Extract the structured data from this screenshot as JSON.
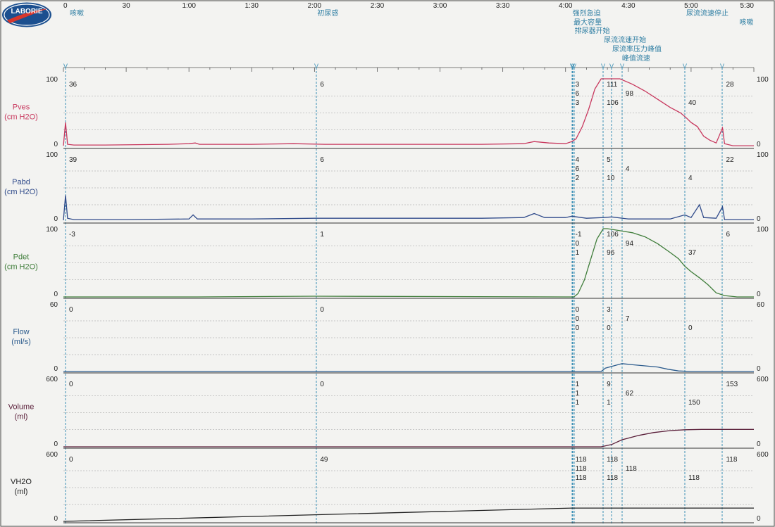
{
  "logo": {
    "text": "LABORIE",
    "colors": {
      "outer": "#1b4f8f",
      "inner": "#ffffff",
      "swoosh": "#d8362c"
    }
  },
  "chart_data": {
    "type": "line",
    "title": "",
    "time_axis": {
      "unit": "seconds",
      "range": [
        0,
        330
      ],
      "ticks": [
        {
          "t": 0,
          "label": "0"
        },
        {
          "t": 30,
          "label": "30"
        },
        {
          "t": 60,
          "label": "1:00"
        },
        {
          "t": 90,
          "label": "1:30"
        },
        {
          "t": 120,
          "label": "2:00"
        },
        {
          "t": 150,
          "label": "2:30"
        },
        {
          "t": 180,
          "label": "3:00"
        },
        {
          "t": 210,
          "label": "3:30"
        },
        {
          "t": 240,
          "label": "4:00"
        },
        {
          "t": 270,
          "label": "4:30"
        },
        {
          "t": 300,
          "label": "5:00"
        },
        {
          "t": 330,
          "label": "5:30"
        }
      ]
    },
    "events": [
      {
        "t": 1,
        "label": "咳嗽"
      },
      {
        "t": 121,
        "label": "初尿感"
      },
      {
        "t": 243,
        "label": "强烈急迫"
      },
      {
        "t": 243.5,
        "label": "最大容量"
      },
      {
        "t": 244,
        "label": "排尿器开始"
      },
      {
        "t": 258,
        "label": "尿流流速开始"
      },
      {
        "t": 262,
        "label": "尿流率压力峰值"
      },
      {
        "t": 267,
        "label": "峰值流速"
      },
      {
        "t": 297,
        "label": "尿流流速停止"
      },
      {
        "t": 315,
        "label": "咳嗽"
      }
    ],
    "channels": [
      {
        "name": "Pves",
        "unit": "(cm H2O)",
        "color": "#c8385e",
        "ymin": 0,
        "ymax": 100,
        "ymin_label": "0",
        "ymax_label": "100",
        "readouts": [
          {
            "t": 1,
            "values": [
              "36"
            ]
          },
          {
            "t": 121,
            "values": [
              "6"
            ]
          },
          {
            "t": 243,
            "values": [
              "3",
              "6",
              "3"
            ]
          },
          {
            "t": 258,
            "values": [
              "111",
              "106"
            ]
          },
          {
            "t": 267,
            "values": [
              "98"
            ]
          },
          {
            "t": 297,
            "values": [
              "40"
            ]
          },
          {
            "t": 315,
            "values": [
              "28"
            ]
          }
        ],
        "points": [
          [
            0,
            2
          ],
          [
            1,
            36
          ],
          [
            2,
            4
          ],
          [
            5,
            3
          ],
          [
            20,
            3
          ],
          [
            50,
            4
          ],
          [
            60,
            5
          ],
          [
            63,
            6
          ],
          [
            65,
            4
          ],
          [
            90,
            4
          ],
          [
            110,
            5
          ],
          [
            125,
            4
          ],
          [
            140,
            4
          ],
          [
            200,
            4
          ],
          [
            220,
            5
          ],
          [
            225,
            8
          ],
          [
            232,
            6
          ],
          [
            240,
            5
          ],
          [
            243,
            8
          ],
          [
            245,
            12
          ],
          [
            248,
            30
          ],
          [
            251,
            55
          ],
          [
            254,
            85
          ],
          [
            257,
            105
          ],
          [
            259,
            111
          ],
          [
            262,
            108
          ],
          [
            266,
            100
          ],
          [
            272,
            92
          ],
          [
            278,
            82
          ],
          [
            284,
            70
          ],
          [
            290,
            58
          ],
          [
            295,
            50
          ],
          [
            298,
            42
          ],
          [
            300,
            36
          ],
          [
            303,
            30
          ],
          [
            306,
            16
          ],
          [
            309,
            10
          ],
          [
            312,
            6
          ],
          [
            315,
            28
          ],
          [
            316,
            5
          ],
          [
            320,
            2
          ],
          [
            330,
            2
          ]
        ]
      },
      {
        "name": "Pabd",
        "unit": "(cm H2O)",
        "color": "#2f4a8a",
        "ymin": 0,
        "ymax": 100,
        "ymin_label": "0",
        "ymax_label": "100",
        "readouts": [
          {
            "t": 1,
            "values": [
              "39"
            ]
          },
          {
            "t": 121,
            "values": [
              "6"
            ]
          },
          {
            "t": 243,
            "values": [
              "4",
              "6",
              "2"
            ]
          },
          {
            "t": 258,
            "values": [
              "5",
              "10"
            ]
          },
          {
            "t": 267,
            "values": [
              "4"
            ]
          },
          {
            "t": 297,
            "values": [
              "4"
            ]
          },
          {
            "t": 315,
            "values": [
              "22"
            ]
          }
        ],
        "points": [
          [
            0,
            2
          ],
          [
            1,
            39
          ],
          [
            2,
            5
          ],
          [
            5,
            3
          ],
          [
            30,
            3
          ],
          [
            60,
            4
          ],
          [
            62,
            10
          ],
          [
            64,
            4
          ],
          [
            90,
            4
          ],
          [
            120,
            5
          ],
          [
            200,
            5
          ],
          [
            220,
            6
          ],
          [
            225,
            12
          ],
          [
            230,
            6
          ],
          [
            240,
            6
          ],
          [
            243,
            8
          ],
          [
            250,
            5
          ],
          [
            258,
            6
          ],
          [
            262,
            7
          ],
          [
            270,
            4
          ],
          [
            290,
            4
          ],
          [
            297,
            10
          ],
          [
            300,
            6
          ],
          [
            304,
            25
          ],
          [
            306,
            6
          ],
          [
            312,
            5
          ],
          [
            315,
            22
          ],
          [
            316,
            3
          ],
          [
            330,
            3
          ]
        ]
      },
      {
        "name": "Pdet",
        "unit": "(cm H2O)",
        "color": "#3f7d3a",
        "ymin": 0,
        "ymax": 100,
        "ymin_label": "0",
        "ymax_label": "100",
        "readouts": [
          {
            "t": 1,
            "values": [
              "-3"
            ]
          },
          {
            "t": 121,
            "values": [
              "1"
            ]
          },
          {
            "t": 243,
            "values": [
              "-1",
              "0",
              "1"
            ]
          },
          {
            "t": 258,
            "values": [
              "106",
              "96"
            ]
          },
          {
            "t": 267,
            "values": [
              "94"
            ]
          },
          {
            "t": 297,
            "values": [
              "37"
            ]
          },
          {
            "t": 315,
            "values": [
              "6"
            ]
          }
        ],
        "points": [
          [
            0,
            0
          ],
          [
            1,
            -3
          ],
          [
            3,
            0
          ],
          [
            60,
            0
          ],
          [
            62,
            -3
          ],
          [
            64,
            0
          ],
          [
            120,
            1
          ],
          [
            240,
            0
          ],
          [
            244,
            -1
          ],
          [
            246,
            5
          ],
          [
            249,
            25
          ],
          [
            252,
            55
          ],
          [
            255,
            85
          ],
          [
            258,
            100
          ],
          [
            260,
            106
          ],
          [
            264,
            98
          ],
          [
            268,
            96
          ],
          [
            272,
            94
          ],
          [
            278,
            88
          ],
          [
            284,
            78
          ],
          [
            290,
            65
          ],
          [
            294,
            56
          ],
          [
            297,
            45
          ],
          [
            300,
            37
          ],
          [
            304,
            28
          ],
          [
            308,
            18
          ],
          [
            312,
            6
          ],
          [
            316,
            2
          ],
          [
            322,
            0
          ],
          [
            330,
            0
          ]
        ]
      },
      {
        "name": "Flow",
        "unit": "(ml/s)",
        "color": "#2a5a8c",
        "ymin": 0,
        "ymax": 60,
        "ymin_label": "0",
        "ymax_label": "60",
        "readouts": [
          {
            "t": 1,
            "values": [
              "0"
            ]
          },
          {
            "t": 121,
            "values": [
              "0"
            ]
          },
          {
            "t": 243,
            "values": [
              "0",
              "0",
              "0"
            ]
          },
          {
            "t": 258,
            "values": [
              "3",
              "0"
            ]
          },
          {
            "t": 267,
            "values": [
              "7"
            ]
          },
          {
            "t": 297,
            "values": [
              "0"
            ]
          }
        ],
        "points": [
          [
            0,
            0
          ],
          [
            257,
            0
          ],
          [
            259,
            3
          ],
          [
            263,
            5
          ],
          [
            267,
            7
          ],
          [
            272,
            6
          ],
          [
            278,
            5
          ],
          [
            284,
            4
          ],
          [
            289,
            2
          ],
          [
            294,
            0.5
          ],
          [
            300,
            0
          ],
          [
            330,
            0
          ]
        ]
      },
      {
        "name": "Volume",
        "unit": "(ml)",
        "color": "#5a1f3a",
        "ymin": 0,
        "ymax": 600,
        "ymin_label": "0",
        "ymax_label": "600",
        "readouts": [
          {
            "t": 1,
            "values": [
              "0"
            ]
          },
          {
            "t": 121,
            "values": [
              "0"
            ]
          },
          {
            "t": 243,
            "values": [
              "1",
              "1",
              "1"
            ]
          },
          {
            "t": 258,
            "values": [
              "9",
              "1"
            ]
          },
          {
            "t": 267,
            "values": [
              "62"
            ]
          },
          {
            "t": 297,
            "values": [
              "150"
            ]
          },
          {
            "t": 315,
            "values": [
              "153"
            ]
          }
        ],
        "points": [
          [
            0,
            0
          ],
          [
            257,
            0
          ],
          [
            262,
            20
          ],
          [
            267,
            62
          ],
          [
            275,
            100
          ],
          [
            282,
            125
          ],
          [
            290,
            142
          ],
          [
            297,
            150
          ],
          [
            305,
            153
          ],
          [
            330,
            153
          ]
        ]
      },
      {
        "name": "VH2O",
        "unit": "(ml)",
        "color": "#222222",
        "ymin": 0,
        "ymax": 600,
        "ymin_label": "0",
        "ymax_label": "600",
        "readouts": [
          {
            "t": 1,
            "values": [
              "0"
            ]
          },
          {
            "t": 121,
            "values": [
              "49"
            ]
          },
          {
            "t": 243,
            "values": [
              "118",
              "118",
              "118"
            ]
          },
          {
            "t": 258,
            "values": [
              "118",
              "118"
            ]
          },
          {
            "t": 267,
            "values": [
              "118"
            ]
          },
          {
            "t": 297,
            "values": [
              "118"
            ]
          },
          {
            "t": 315,
            "values": [
              "118"
            ]
          }
        ],
        "points": [
          [
            0,
            0
          ],
          [
            243,
            118
          ],
          [
            330,
            118
          ]
        ]
      }
    ]
  }
}
